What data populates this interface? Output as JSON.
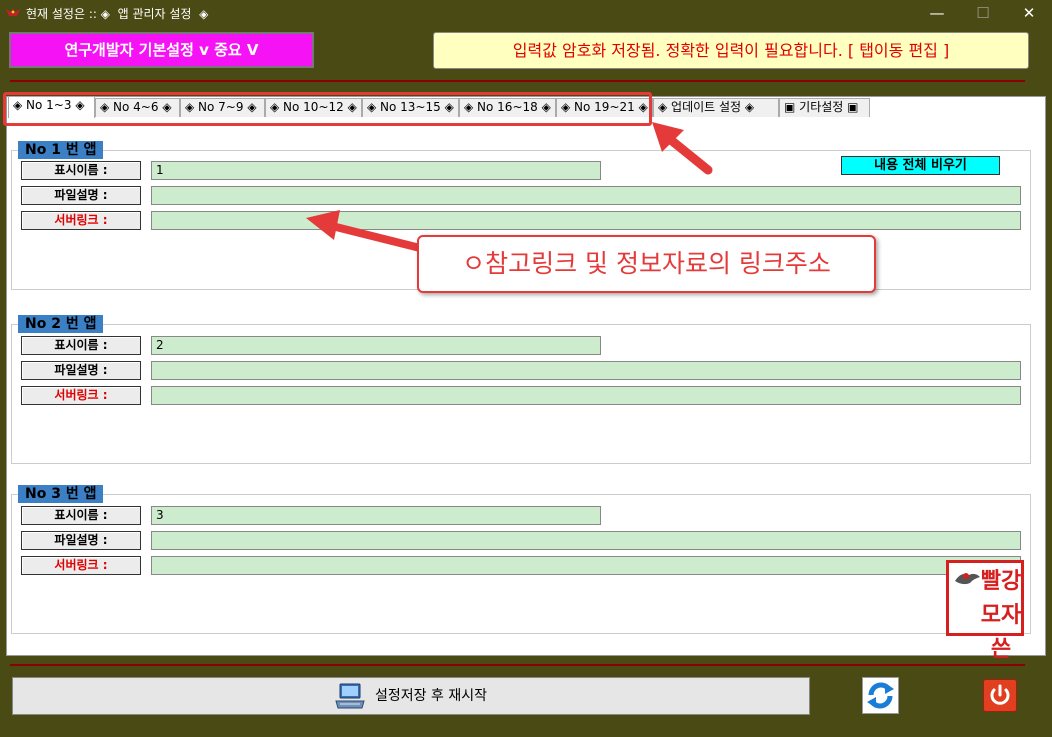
{
  "window": {
    "title": "현재 설정은 :: ◈  앱 관리자 설정  ◈",
    "minimize_symbol": "—",
    "maximize_symbol": "☐",
    "close_symbol": "✕"
  },
  "header": {
    "mode_button_label": "연구개발자 기본설정 v 중요 V",
    "notice_text": "입력값 암호화 저장됨. 정확한 입력이 필요합니다. [ 탭이동 편집 ]"
  },
  "tabs": [
    {
      "label": "◈ No 1~3 ◈",
      "active": true
    },
    {
      "label": "◈ No 4~6 ◈"
    },
    {
      "label": "◈ No 7~9 ◈"
    },
    {
      "label": "◈ No 10~12 ◈"
    },
    {
      "label": "◈ No 13~15 ◈"
    },
    {
      "label": "◈ No 16~18 ◈"
    },
    {
      "label": "◈ No 19~21 ◈"
    },
    {
      "label": "◈  업데이트 설정  ◈"
    },
    {
      "label": "▣ 기타설정 ▣"
    }
  ],
  "apps": [
    {
      "title": "No 1 번 앱",
      "name_label": "표시이름 :",
      "name_value": "1",
      "desc_label": "파일설명 :",
      "desc_value": "",
      "link_label": "서버링크 :",
      "link_value": ""
    },
    {
      "title": "No 2 번 앱",
      "name_label": "표시이름 :",
      "name_value": "2",
      "desc_label": "파일설명 :",
      "desc_value": "",
      "link_label": "서버링크 :",
      "link_value": ""
    },
    {
      "title": "No 3 번 앱",
      "name_label": "표시이름 :",
      "name_value": "3",
      "desc_label": "파일설명 :",
      "desc_value": "",
      "link_label": "서버링크 :",
      "link_value": ""
    }
  ],
  "clear_all_label": "내용 전체 비우기",
  "annotation_text": "ㅇ참고링크 및 정보자료의 링크주소",
  "stamp_text": "빨강모자쓴",
  "footer": {
    "save_label": "설정저장 후 재시작"
  },
  "colors": {
    "background": "#4a4a14",
    "accent_magenta": "#f513f5",
    "notice_bg": "#ffffc0",
    "field_green": "#cdeccd",
    "group_title_blue": "#3b7fc4",
    "annotation_red": "#e53a3a"
  },
  "icons": [
    "app-logo-icon",
    "minimize-icon",
    "maximize-icon",
    "close-icon",
    "keyboard-computer-icon",
    "refresh-icon",
    "power-icon"
  ]
}
